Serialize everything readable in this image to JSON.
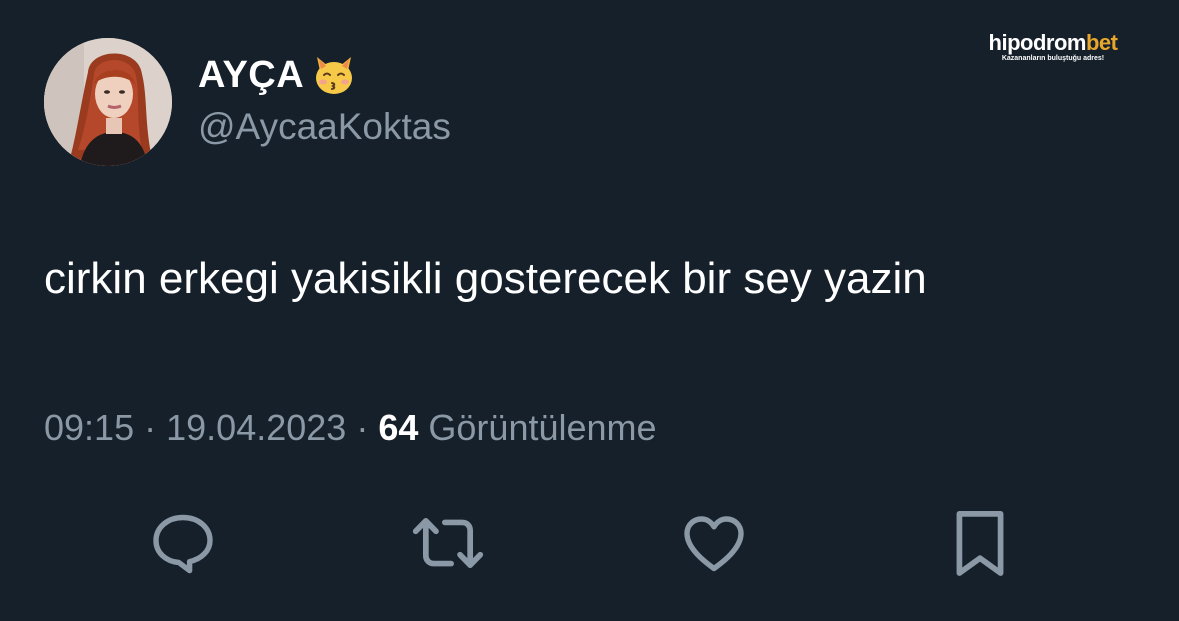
{
  "author": {
    "display_name": "AYÇA",
    "name_emoji": "kissing-cat-emoji",
    "handle": "@AycaaKoktas",
    "avatar": "profile-photo"
  },
  "watermark": {
    "brand_prefix": "hipodrom",
    "brand_suffix": "bet",
    "tagline": "Kazananların buluştuğu adres!"
  },
  "tweet": {
    "text": "cirkin erkegi yakisikli gosterecek bir sey yazin"
  },
  "meta": {
    "time": "09:15",
    "separator": "·",
    "date": "19.04.2023",
    "views_count": "64",
    "views_label": "Görüntülenme"
  },
  "actions": {
    "reply_icon": "reply-icon",
    "retweet_icon": "retweet-icon",
    "like_icon": "heart-icon",
    "bookmark_icon": "bookmark-icon"
  },
  "colors": {
    "background": "#15202b",
    "primary_text": "#ffffff",
    "secondary_text": "#8b98a5",
    "watermark_accent": "#e8a62c"
  }
}
